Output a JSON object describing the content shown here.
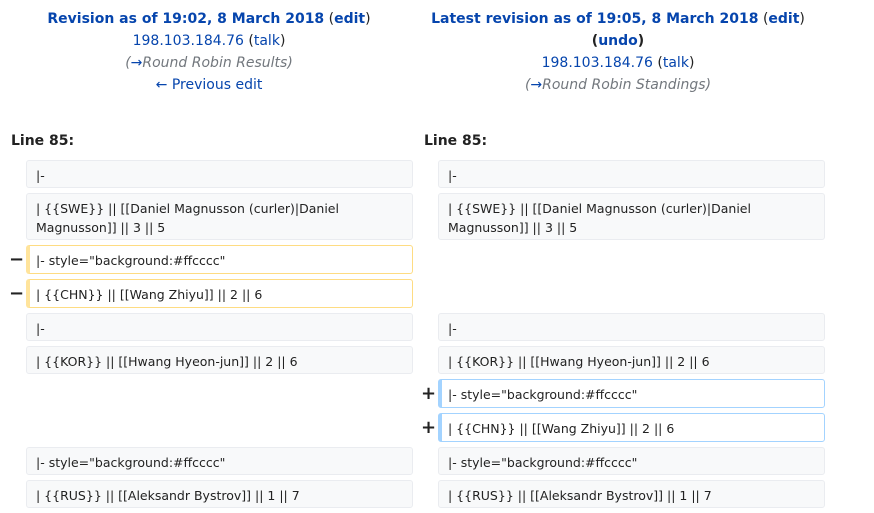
{
  "left_header": {
    "title": "Revision as of 19:02, 8 March 2018",
    "edit_label": "edit",
    "user": "198.103.184.76",
    "talk_label": "talk",
    "summary_arrow": "→",
    "summary": "Round Robin Results",
    "prev_link": "← Previous edit"
  },
  "right_header": {
    "title": "Latest revision as of 19:05, 8 March 2018",
    "edit_label": "edit",
    "undo_label": "undo",
    "user": "198.103.184.76",
    "talk_label": "talk",
    "summary_arrow": "→",
    "summary": "Round Robin Standings"
  },
  "line_left": "Line 85:",
  "line_right": "Line 85:",
  "markers": {
    "minus": "−",
    "plus": "+"
  },
  "rows": {
    "l1": "|-",
    "l2": "| {{SWE}} || [[Daniel Magnusson (curler)|Daniel Magnusson]] || 3 || 5",
    "l3": "|- style=\"background:#ffcccc\"",
    "l4": "| {{CHN}} || [[Wang Zhiyu]] || 2 || 6",
    "l5": "|-",
    "l6": "| {{KOR}} || [[Hwang Hyeon-jun]] || 2 || 6",
    "l7": "|- style=\"background:#ffcccc\"",
    "l8": "| {{RUS}} || [[Aleksandr Bystrov]] || 1 || 7",
    "r1": "|-",
    "r2": "| {{SWE}} || [[Daniel Magnusson (curler)|Daniel Magnusson]] || 3 || 5",
    "r3": "|-",
    "r4": "| {{KOR}} || [[Hwang Hyeon-jun]] || 2 || 6",
    "r5": "|- style=\"background:#ffcccc\"",
    "r6": "| {{CHN}} || [[Wang Zhiyu]] || 2 || 6",
    "r7": "|- style=\"background:#ffcccc\"",
    "r8": "| {{RUS}} || [[Aleksandr Bystrov]] || 1 || 7"
  }
}
